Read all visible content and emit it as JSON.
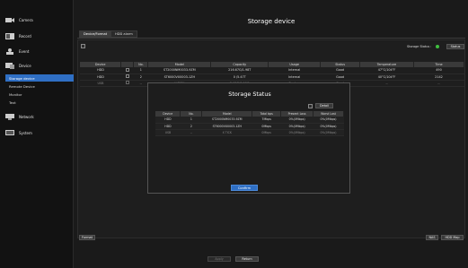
{
  "sidebar": {
    "items": [
      {
        "label": "Camera",
        "icon": "camera-icon"
      },
      {
        "label": "Record",
        "icon": "record-icon"
      },
      {
        "label": "Event",
        "icon": "event-icon"
      },
      {
        "label": "Device",
        "icon": "device-icon"
      },
      {
        "label": "Network",
        "icon": "network-icon"
      },
      {
        "label": "System",
        "icon": "system-icon"
      }
    ],
    "sub_items": [
      {
        "label": "Storage device",
        "active": true
      },
      {
        "label": "Remote Device",
        "active": false
      },
      {
        "label": "Monitor",
        "active": false
      },
      {
        "label": "Text",
        "active": false
      }
    ]
  },
  "page": {
    "title": "Storage device",
    "tabs": [
      "Device/Format",
      "HDD alarm"
    ],
    "status_label": "Storage Status :",
    "status_button": "Status",
    "status_color": "#3fbf3f"
  },
  "table": {
    "headers": [
      "Device",
      "",
      "No.",
      "Model",
      "Capacity",
      "Usage",
      "Status",
      "Temperature",
      "Time"
    ],
    "rows": [
      {
        "device": "HDD",
        "no": "1",
        "model": "ST2000NM0033-9ZM",
        "capacity": "216.67G/1.98T",
        "usage": "Internal",
        "status": "Good",
        "temperature": "47°C/104°F",
        "time": "490",
        "dim": false
      },
      {
        "device": "HDD",
        "no": "2",
        "model": "ST6000VX0003-1ZH",
        "capacity": "0 /5.47T",
        "usage": "Internal",
        "status": "Good",
        "temperature": "40°C/104°F",
        "time": "2142",
        "dim": false
      },
      {
        "device": "USB",
        "no": "--",
        "model": "X TICK",
        "capacity": "2.15G/1.99G",
        "usage": "Backup",
        "status": "Good",
        "temperature": "--",
        "time": "--",
        "dim": true
      }
    ]
  },
  "popup": {
    "title": "Storage Status",
    "detail_button": "Detail",
    "headers": [
      "Device",
      "No.",
      "Model",
      "Total bps",
      "Present Loss",
      "Worst Lost"
    ],
    "rows": [
      {
        "device": "HDD",
        "no": "1",
        "model": "ST2000NM0033-9ZM",
        "total": "7Mbps",
        "present": "0%(0Mbps)",
        "worst": "0%(0Mbps)",
        "dim": false
      },
      {
        "device": "HDD",
        "no": "2",
        "model": "ST6000VX0003-1ZH",
        "total": "0Mbps",
        "present": "0%(0Mbps)",
        "worst": "0%(0Mbps)",
        "dim": false
      },
      {
        "device": "USB",
        "no": "--",
        "model": "X TICK",
        "total": "0Mbps",
        "present": "0%(0Mbps)",
        "worst": "0%(0Mbps)",
        "dim": true
      }
    ],
    "confirm": "Confirm"
  },
  "footer": {
    "format": "Format",
    "nas": "NAS",
    "hdd_map": "HDD Map",
    "apply": "Apply",
    "return": "Return"
  }
}
